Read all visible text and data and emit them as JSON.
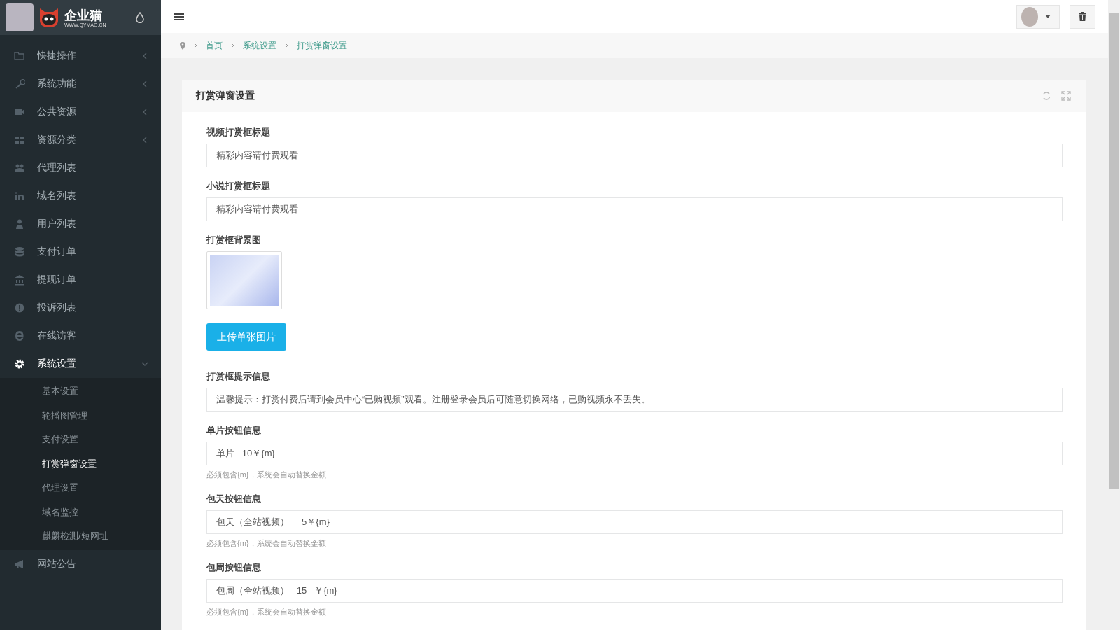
{
  "brand": {
    "name": "企业猫",
    "url": "WWW.QYMAO.CN"
  },
  "sidebar": {
    "items": [
      {
        "label": "快捷操作",
        "kind": "menu",
        "expanded": false,
        "selected": false
      },
      {
        "label": "系统功能",
        "kind": "menu",
        "expanded": false,
        "selected": false
      },
      {
        "label": "公共资源",
        "kind": "menu",
        "expanded": false,
        "selected": false
      },
      {
        "label": "资源分类",
        "kind": "menu",
        "expanded": false,
        "selected": false
      },
      {
        "label": "代理列表",
        "kind": "link",
        "selected": false
      },
      {
        "label": "域名列表",
        "kind": "link",
        "selected": false
      },
      {
        "label": "用户列表",
        "kind": "link",
        "selected": false
      },
      {
        "label": "支付订单",
        "kind": "link",
        "selected": false
      },
      {
        "label": "提现订单",
        "kind": "link",
        "selected": false
      },
      {
        "label": "投诉列表",
        "kind": "link",
        "selected": false
      },
      {
        "label": "在线访客",
        "kind": "link",
        "selected": false
      },
      {
        "label": "系统设置",
        "kind": "menu",
        "expanded": true,
        "selected": true,
        "children": [
          {
            "label": "基本设置",
            "selected": false
          },
          {
            "label": "轮播图管理",
            "selected": false
          },
          {
            "label": "支付设置",
            "selected": false
          },
          {
            "label": "打赏弹窗设置",
            "selected": true
          },
          {
            "label": "代理设置",
            "selected": false
          },
          {
            "label": "域名监控",
            "selected": false
          },
          {
            "label": "麒麟检测/短网址",
            "selected": false
          }
        ]
      },
      {
        "label": "网站公告",
        "kind": "link",
        "selected": false
      }
    ]
  },
  "breadcrumb": [
    "首页",
    "系统设置",
    "打赏弹窗设置"
  ],
  "panel": {
    "title": "打赏弹窗设置",
    "fields": [
      {
        "kind": "text",
        "label": "视频打赏框标题",
        "value": "精彩内容请付费观看"
      },
      {
        "kind": "text",
        "label": "小说打赏框标题",
        "value": "精彩内容请付费观看"
      },
      {
        "kind": "image",
        "label": "打赏框背景图",
        "button": "上传单张图片"
      },
      {
        "kind": "text",
        "label": "打赏框提示信息",
        "value": "温馨提示：打赏付费后请到会员中心“已购视频”观看。注册登录会员后可随意切换网络，已购视频永不丢失。"
      },
      {
        "kind": "text",
        "label": "单片按钮信息",
        "value": "单片   10￥{m}",
        "hint": "必须包含{m}，系统会自动替换金额"
      },
      {
        "kind": "text",
        "label": "包天按钮信息",
        "value": "包天（全站视频）     5￥{m}",
        "hint": "必须包含{m}，系统会自动替换金额"
      },
      {
        "kind": "text",
        "label": "包周按钮信息",
        "value": "包周（全站视频）   15   ￥{m}",
        "hint": "必须包含{m}，系统会自动替换金额"
      }
    ]
  }
}
